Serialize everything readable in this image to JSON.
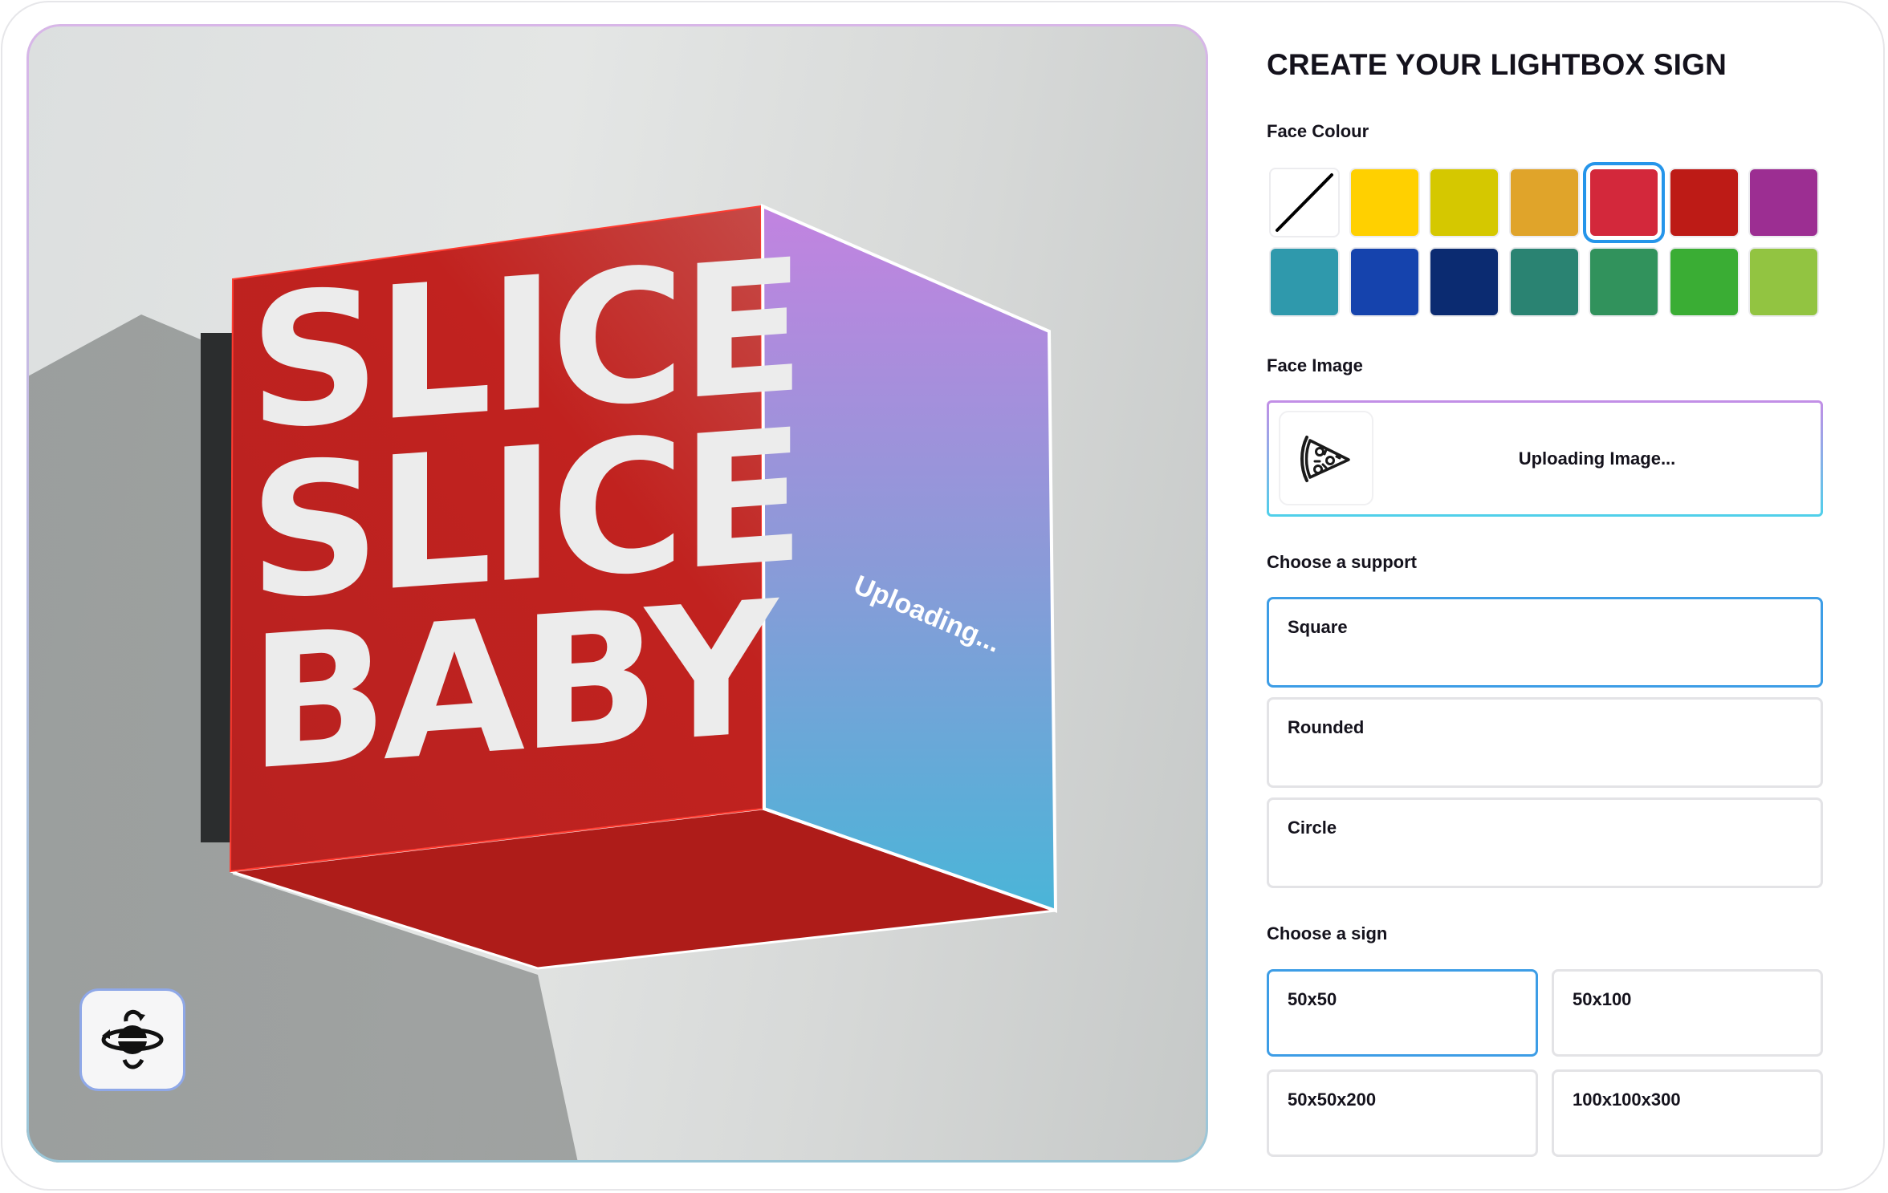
{
  "preview": {
    "sign_lines": [
      "SLICE",
      "SLICE",
      "BABY"
    ],
    "side_face_status": "Uploading...",
    "colors": {
      "front_face": "#c0221e",
      "bottom_face": "#ae1c19",
      "side_gradient_top": "#c283e0",
      "side_gradient_bottom": "#4ab5d8",
      "sign_text": "#ececec"
    },
    "app_badge_icon": "planet-orbit-icon"
  },
  "config": {
    "title": "CREATE YOUR LIGHTBOX SIGN",
    "face_colour": {
      "label": "Face Colour",
      "selected_index": 4,
      "swatches": [
        {
          "name": "none",
          "color": "#ffffff"
        },
        {
          "name": "yellow",
          "color": "#ffd000"
        },
        {
          "name": "olive-yellow",
          "color": "#d5c800"
        },
        {
          "name": "amber",
          "color": "#e0a42a"
        },
        {
          "name": "red",
          "color": "#d3283b"
        },
        {
          "name": "dark-red",
          "color": "#bd1b16"
        },
        {
          "name": "purple",
          "color": "#9c2e92"
        },
        {
          "name": "teal",
          "color": "#2f99ac"
        },
        {
          "name": "blue",
          "color": "#1543ad"
        },
        {
          "name": "navy",
          "color": "#0b2b71"
        },
        {
          "name": "sea-green",
          "color": "#2a8372"
        },
        {
          "name": "green",
          "color": "#31925c"
        },
        {
          "name": "bright-green",
          "color": "#3aad34"
        },
        {
          "name": "lime",
          "color": "#92c441"
        }
      ]
    },
    "face_image": {
      "label": "Face Image",
      "thumbnail_icon": "pizza-slice-icon",
      "status": "Uploading Image..."
    },
    "support": {
      "label": "Choose a support",
      "selected_index": 0,
      "options": [
        "Square",
        "Rounded",
        "Circle"
      ]
    },
    "sign": {
      "label": "Choose a sign",
      "selected_index": 0,
      "options": [
        "50x50",
        "50x100",
        "50x50x200",
        "100x100x300"
      ]
    },
    "selection_color": "#2595ea"
  }
}
